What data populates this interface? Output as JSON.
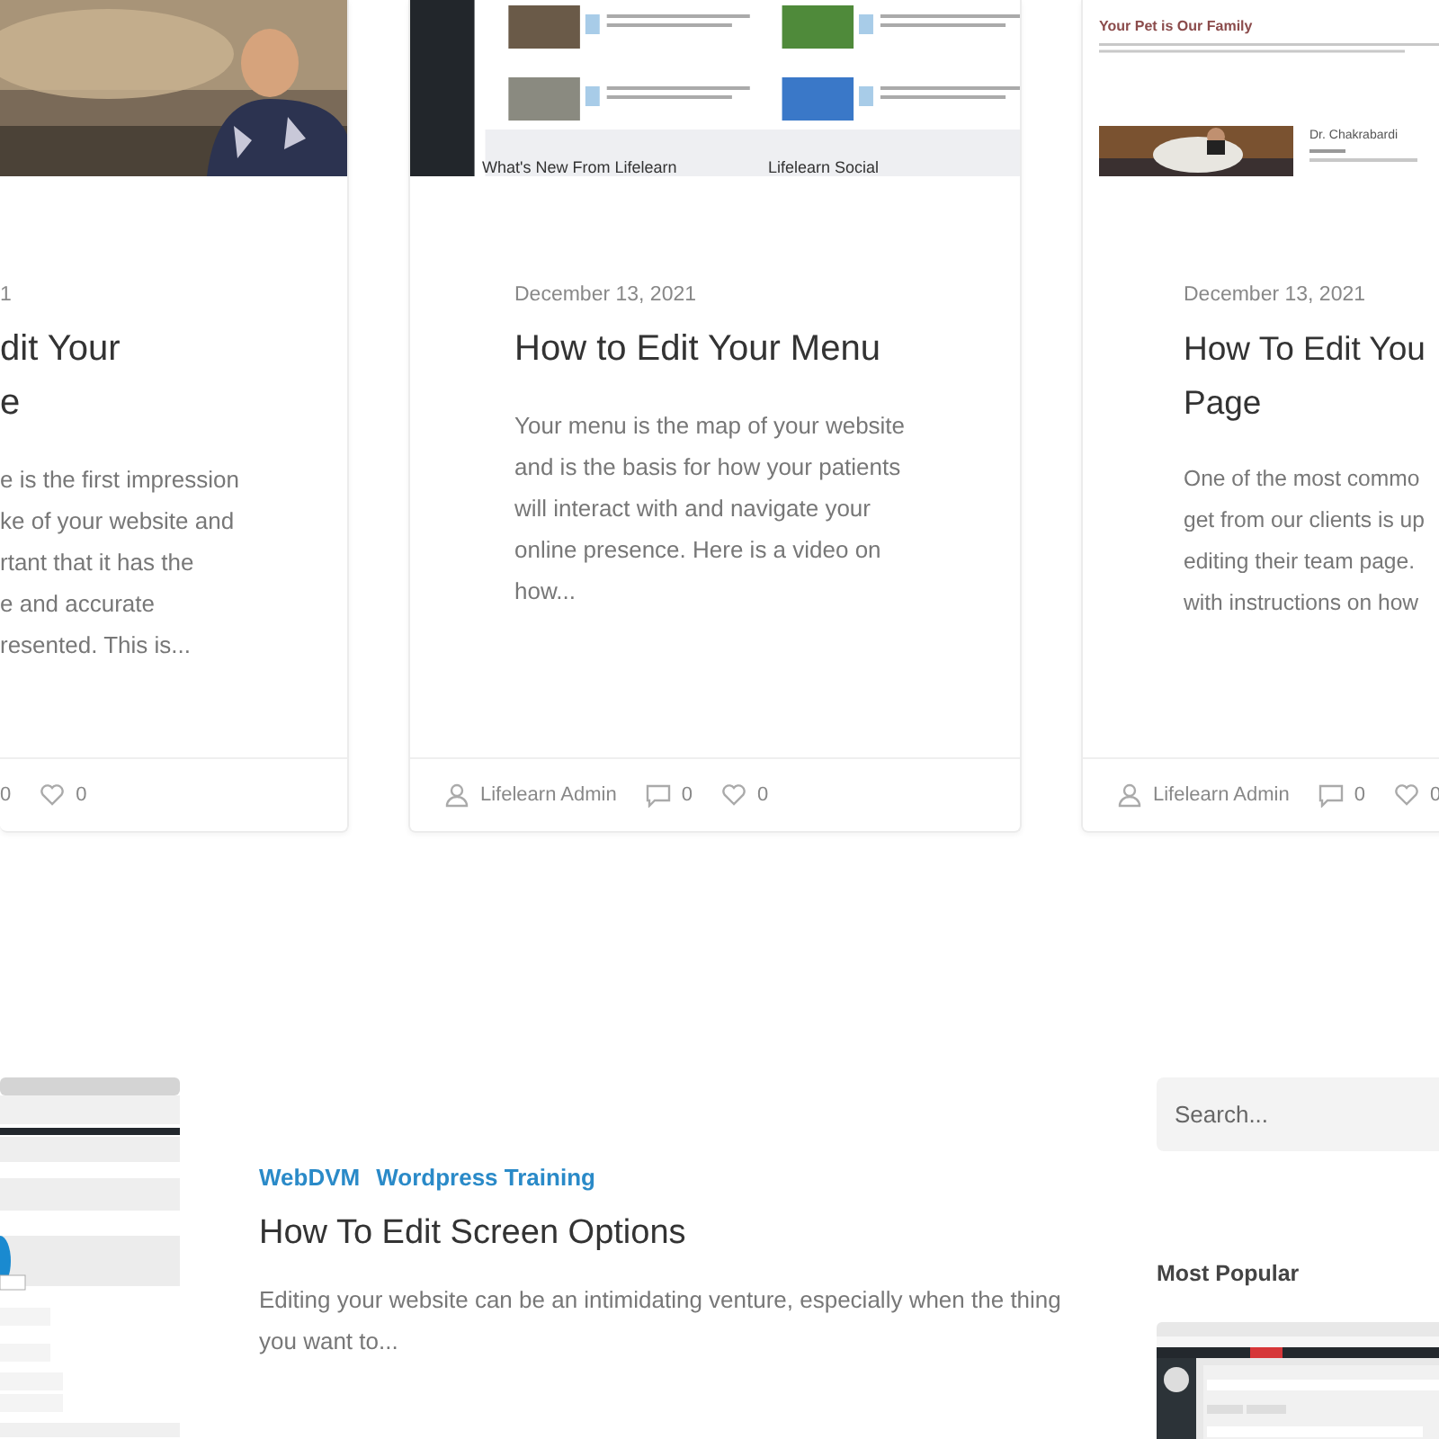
{
  "posts": [
    {
      "cut_left": true,
      "cut_right": false,
      "thumbnail": {
        "kind": "picture"
      },
      "date": "1",
      "title_lines": [
        "dit Your",
        "e"
      ],
      "excerpt_lines": [
        "e is the first impression",
        "ke of your website and",
        "rtant that it has the",
        "e and accurate",
        "resented. This is..."
      ],
      "comments": "0",
      "likes": "0"
    },
    {
      "cut_left": false,
      "cut_right": false,
      "thumbnail": {
        "kind": "site",
        "headings": [
          "What's New From Lifelearn",
          "Lifelearn Social"
        ]
      },
      "date": "December 13, 2021",
      "title_lines": [
        "How to Edit Your Menu"
      ],
      "excerpt_lines": [
        "Your menu is the map of your website",
        "and is the basis for how your patients",
        "will interact with and navigate your",
        "online presence. Here is a video on",
        "how..."
      ],
      "author": "Lifelearn Admin",
      "comments": "0",
      "likes": "0"
    },
    {
      "cut_left": false,
      "cut_right": true,
      "thumbnail": {
        "kind": "team",
        "headings": [
          "Your Pet is Our Family",
          "Dr. Chakrabardi"
        ]
      },
      "date": "December 13, 2021",
      "title_lines": [
        "How To Edit You",
        "Page"
      ],
      "excerpt_lines": [
        "One of the most commo",
        "get from our clients is up",
        "editing their team page.",
        "with instructions on how"
      ],
      "author": "Lifelearn Admin",
      "comments": "0",
      "likes": "0"
    }
  ],
  "feature": {
    "categories": [
      "WebDVM",
      "Wordpress Training"
    ],
    "title": "How To Edit Screen Options",
    "excerpt_lines": [
      "Editing your website can be an intimidating venture, especially when the thing",
      "you want to..."
    ]
  },
  "sidebar": {
    "search": {
      "placeholder": "Search..."
    },
    "heading": "Most Popular"
  }
}
